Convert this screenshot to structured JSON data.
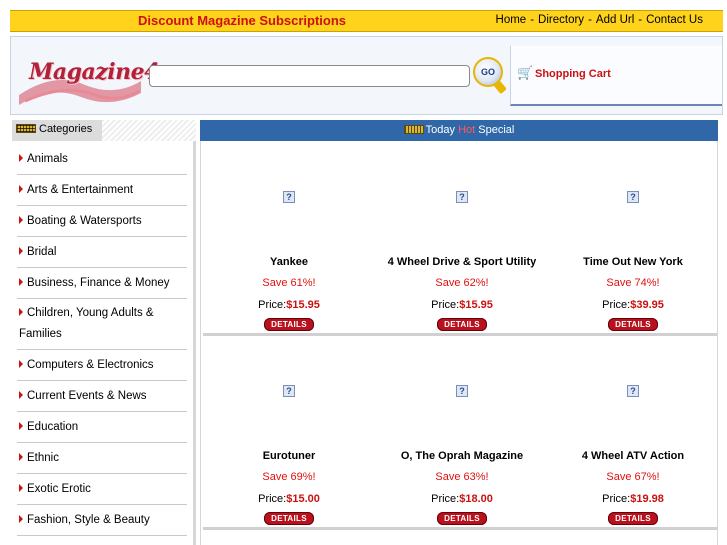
{
  "topbar": {
    "site_title": "Discount Magazine Subscriptions",
    "nav": [
      "Home",
      "Directory",
      "Add Url",
      "Contact Us"
    ]
  },
  "header": {
    "logo_text": "Magazine4u",
    "search": {
      "value": "",
      "placeholder": ""
    },
    "go_label": "GO",
    "cart_label": "Shopping Cart"
  },
  "sidebar": {
    "title": "Categories",
    "items": [
      "Animals",
      "Arts & Entertainment",
      "Boating & Watersports",
      "Bridal",
      "Business, Finance & Money",
      "Children, Young Adults & Families",
      "Computers & Electronics",
      "Current Events & News",
      "Education",
      "Ethnic",
      "Exotic Erotic",
      "Fashion, Style & Beauty"
    ]
  },
  "main": {
    "header_left": "Today",
    "header_hot": "Hot",
    "header_right": "Special",
    "products": [
      {
        "name": "Yankee",
        "save": "Save 61%!",
        "price_label": "Price:",
        "price": "$15.95",
        "details": "DETAILS"
      },
      {
        "name": "4 Wheel Drive & Sport Utility",
        "save": "Save 62%!",
        "price_label": "Price:",
        "price": "$15.95",
        "details": "DETAILS"
      },
      {
        "name": "Time Out New York",
        "save": "Save 74%!",
        "price_label": "Price:",
        "price": "$39.95",
        "details": "DETAILS"
      },
      {
        "name": "Eurotuner",
        "save": "Save 69%!",
        "price_label": "Price:",
        "price": "$15.00",
        "details": "DETAILS"
      },
      {
        "name": "O, The Oprah Magazine",
        "save": "Save 63%!",
        "price_label": "Price:",
        "price": "$18.00",
        "details": "DETAILS"
      },
      {
        "name": "4 Wheel ATV Action",
        "save": "Save 67%!",
        "price_label": "Price:",
        "price": "$19.98",
        "details": "DETAILS"
      }
    ]
  },
  "colors": {
    "topbar_bg": "#ffd21c",
    "title_red": "#cc1111",
    "header_blue": "#2f67a8",
    "button_red": "#b8121e"
  }
}
